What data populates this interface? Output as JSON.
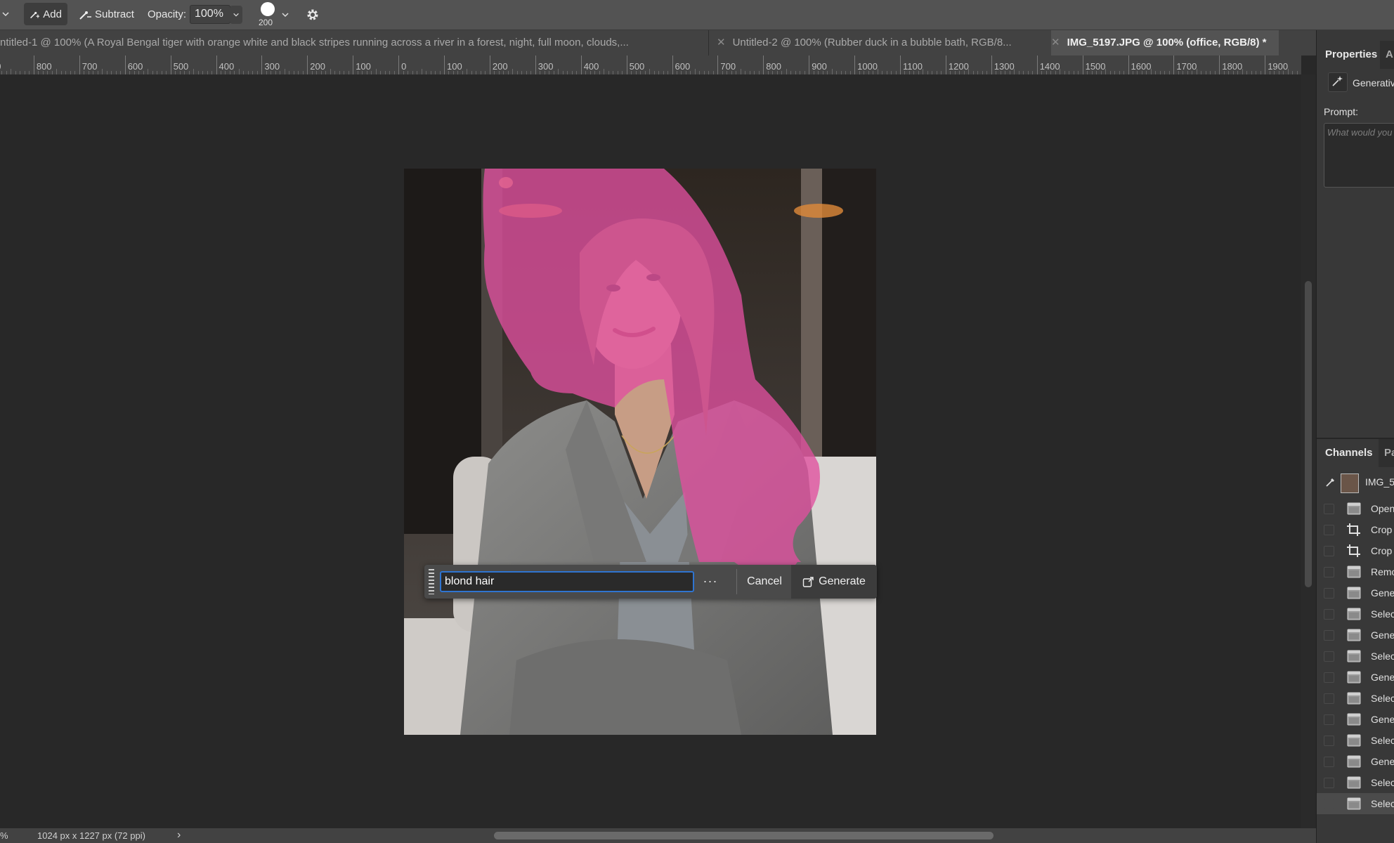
{
  "options": {
    "add_label": "Add",
    "subtract_label": "Subtract",
    "opacity_label": "Opacity:",
    "opacity_value": "100%",
    "brush_size": "200"
  },
  "tabs": [
    {
      "title": "ntitled-1 @ 100% (A Royal Bengal tiger with orange white and black stripes running across a river in a forest, night, full moon, clouds,..."
    },
    {
      "title": "Untitled-2 @ 100% (Rubber duck in a bubble bath, RGB/8..."
    },
    {
      "title": "IMG_5197.JPG @ 100% (office, RGB/8) *"
    }
  ],
  "ruler_labels": [
    "00",
    "800",
    "700",
    "600",
    "500",
    "400",
    "300",
    "200",
    "100",
    "0",
    "100",
    "200",
    "300",
    "400",
    "500",
    "600",
    "700",
    "800",
    "900",
    "1000",
    "1100",
    "1200",
    "1300",
    "1400",
    "1500",
    "1600",
    "1700",
    "1800",
    "1900"
  ],
  "task_bar": {
    "prompt_value": "blond hair",
    "more_label": "···",
    "cancel_label": "Cancel",
    "generate_label": "Generate"
  },
  "properties": {
    "tab_properties": "Properties",
    "tab_adjust": "A",
    "layer_label": "Generativ",
    "prompt_label": "Prompt:",
    "prompt_placeholder": "What would you"
  },
  "history": {
    "tab_channels": "Channels",
    "tab_paths": "Pa",
    "snapshot_label": "IMG_5",
    "items": [
      {
        "label": "Open",
        "icon": "document-icon"
      },
      {
        "label": "Crop",
        "icon": "crop-icon"
      },
      {
        "label": "Crop",
        "icon": "crop-icon"
      },
      {
        "label": "Remo",
        "icon": "document-icon"
      },
      {
        "label": "Gene",
        "icon": "document-icon"
      },
      {
        "label": "Selec",
        "icon": "document-icon"
      },
      {
        "label": "Gene",
        "icon": "document-icon"
      },
      {
        "label": "Selec",
        "icon": "document-icon"
      },
      {
        "label": "Gene",
        "icon": "document-icon"
      },
      {
        "label": "Selec",
        "icon": "document-icon"
      },
      {
        "label": "Gene",
        "icon": "document-icon"
      },
      {
        "label": "Selec",
        "icon": "document-icon"
      },
      {
        "label": "Gene",
        "icon": "document-icon"
      },
      {
        "label": "Selec",
        "icon": "document-icon"
      },
      {
        "label": "Selec",
        "icon": "document-icon"
      }
    ]
  },
  "status": {
    "zoom": "%",
    "doc_info": "1024 px x 1227 px (72 ppi)",
    "arrow": "›"
  },
  "colors": {
    "mask_overlay": "#e0509f",
    "focus_blue": "#2f74d0"
  }
}
